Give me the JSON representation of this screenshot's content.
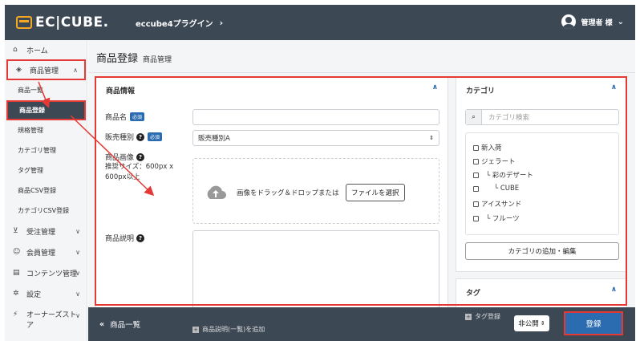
{
  "header": {
    "logo": "EC|CUBE.",
    "shop_name": "eccube4プラグイン",
    "shop_chevron": "›",
    "user_label": "管理者 様",
    "user_chevron": "⌄"
  },
  "sidebar": {
    "home": "ホーム",
    "product": "商品管理",
    "product_items": [
      "商品一覧",
      "商品登録",
      "規格管理",
      "カテゴリ管理",
      "タグ管理",
      "商品CSV登録",
      "カテゴリCSV登録"
    ],
    "order": "受注管理",
    "member": "会員管理",
    "content": "コンテンツ管理",
    "setting": "設定",
    "owners": "オーナーズストア"
  },
  "page": {
    "title": "商品登録",
    "subtitle": "商品管理"
  },
  "product_info": {
    "title": "商品情報",
    "name_label": "商品名",
    "required": "必須",
    "type_label": "販売種別",
    "type_value": "販売種別A",
    "image_label": "商品画像",
    "image_hint": "推奨サイズ：600px x 600px以上",
    "drop_text": "画像をドラッグ＆ドロップまたは",
    "file_button": "ファイルを選択",
    "desc_label": "商品説明",
    "desc_list_link": "商品説明(一覧)を追加"
  },
  "category": {
    "title": "カテゴリ",
    "search_placeholder": "カテゴリ検索",
    "items": [
      "新入荷",
      "ジェラート",
      "└ 彩のデザート",
      "└ CUBE",
      "アイスサンド",
      "└ フルーツ"
    ],
    "add_button": "カテゴリの追加・編集"
  },
  "tag": {
    "title": "タグ",
    "register": "タグ登録"
  },
  "footer": {
    "back_label": "商品一覧",
    "visibility": "非公開",
    "submit": "登録"
  },
  "colors": {
    "header": "#3d4855",
    "accent": "#2b6cb0",
    "annotation": "#e53935"
  }
}
